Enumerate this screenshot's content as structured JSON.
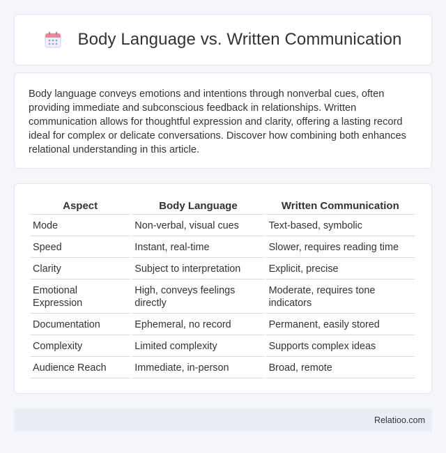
{
  "header": {
    "title": "Body Language vs. Written Communication",
    "icon": "calendar-icon"
  },
  "intro": {
    "text": "Body language conveys emotions and intentions through nonverbal cues, often providing immediate and subconscious feedback in relationships. Written communication allows for thoughtful expression and clarity, offering a lasting record ideal for complex or delicate conversations. Discover how combining both enhances relational understanding in this article."
  },
  "table": {
    "headers": [
      "Aspect",
      "Body Language",
      "Written Communication"
    ],
    "rows": [
      [
        "Mode",
        "Non-verbal, visual cues",
        "Text-based, symbolic"
      ],
      [
        "Speed",
        "Instant, real-time",
        "Slower, requires reading time"
      ],
      [
        "Clarity",
        "Subject to interpretation",
        "Explicit, precise"
      ],
      [
        "Emotional Expression",
        "High, conveys feelings directly",
        "Moderate, requires tone indicators"
      ],
      [
        "Documentation",
        "Ephemeral, no record",
        "Permanent, easily stored"
      ],
      [
        "Complexity",
        "Limited complexity",
        "Supports complex ideas"
      ],
      [
        "Audience Reach",
        "Immediate, in-person",
        "Broad, remote"
      ]
    ]
  },
  "footer": {
    "text": "Relatioo.com"
  }
}
